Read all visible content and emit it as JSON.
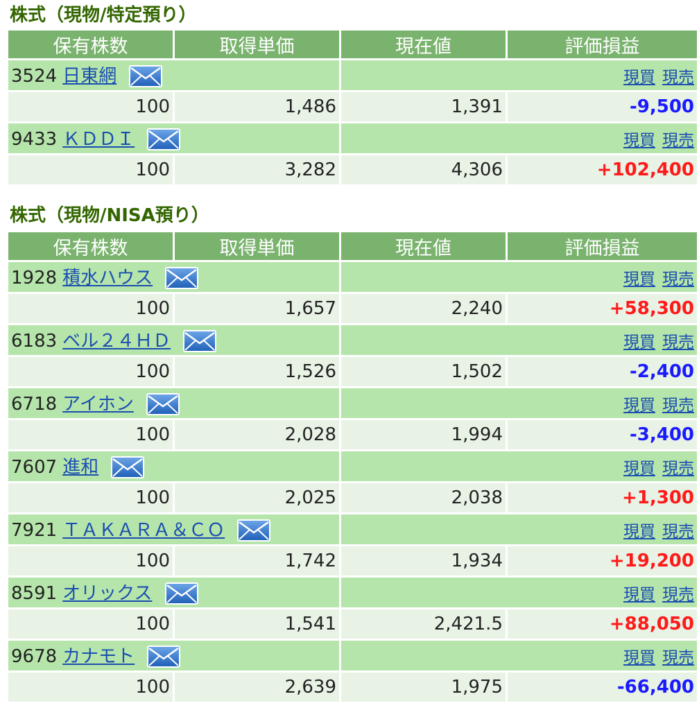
{
  "sections": [
    {
      "title": "株式（現物/特定預り）",
      "headers": [
        "保有株数",
        "取得単価",
        "現在値",
        "評価損益"
      ],
      "rows": [
        {
          "code": "3524",
          "name": "日東網",
          "link1": "現買",
          "link2": "現売",
          "qty": "100",
          "cost": "1,486",
          "price": "1,391",
          "pl": "-9,500",
          "pl_color": "#1a1aff"
        },
        {
          "code": "9433",
          "name": "ＫＤＤＩ",
          "link1": "現買",
          "link2": "現売",
          "qty": "100",
          "cost": "3,282",
          "price": "4,306",
          "pl": "+102,400",
          "pl_color": "#ff1a1a"
        }
      ]
    },
    {
      "title": "株式（現物/NISA預り）",
      "headers": [
        "保有株数",
        "取得単価",
        "現在値",
        "評価損益"
      ],
      "rows": [
        {
          "code": "1928",
          "name": "積水ハウス",
          "link1": "現買",
          "link2": "現売",
          "qty": "100",
          "cost": "1,657",
          "price": "2,240",
          "pl": "+58,300",
          "pl_color": "#ff1a1a"
        },
        {
          "code": "6183",
          "name": "ベル２４ＨＤ",
          "link1": "現買",
          "link2": "現売",
          "qty": "100",
          "cost": "1,526",
          "price": "1,502",
          "pl": "-2,400",
          "pl_color": "#1a1aff"
        },
        {
          "code": "6718",
          "name": "アイホン",
          "link1": "現買",
          "link2": "現売",
          "qty": "100",
          "cost": "2,028",
          "price": "1,994",
          "pl": "-3,400",
          "pl_color": "#1a1aff"
        },
        {
          "code": "7607",
          "name": "進和",
          "link1": "現買",
          "link2": "現売",
          "qty": "100",
          "cost": "2,025",
          "price": "2,038",
          "pl": "+1,300",
          "pl_color": "#ff1a1a"
        },
        {
          "code": "7921",
          "name": "ＴＡＫＡＲＡ＆ＣＯ",
          "link1": "現買",
          "link2": "現売",
          "qty": "100",
          "cost": "1,742",
          "price": "1,934",
          "pl": "+19,200",
          "pl_color": "#ff1a1a"
        },
        {
          "code": "8591",
          "name": "オリックス",
          "link1": "現買",
          "link2": "現売",
          "qty": "100",
          "cost": "1,541",
          "price": "2,421.5",
          "pl": "+88,050",
          "pl_color": "#ff1a1a"
        },
        {
          "code": "9678",
          "name": "カナモト",
          "link1": "現買",
          "link2": "現売",
          "qty": "100",
          "cost": "2,639",
          "price": "1,975",
          "pl": "-66,400",
          "pl_color": "#1a1aff"
        }
      ]
    }
  ]
}
